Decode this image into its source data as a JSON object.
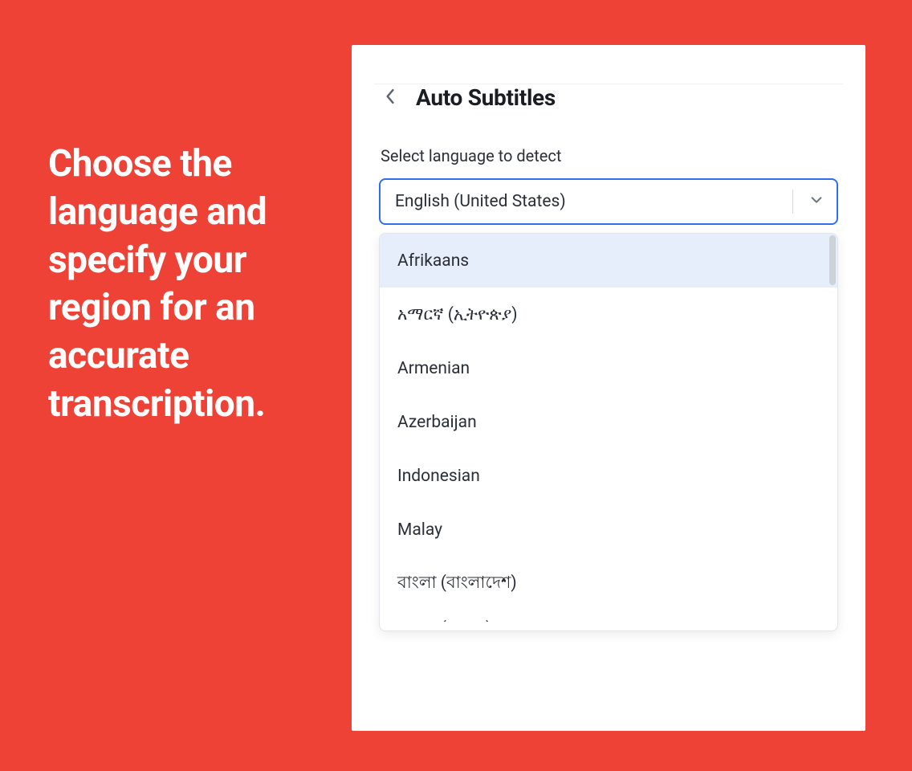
{
  "promo": {
    "text": "Choose the language and specify your region for an accurate transcription."
  },
  "panel": {
    "title": "Auto Subtitles",
    "field_label": "Select language to detect",
    "selected_value": "English (United States)",
    "options": [
      "Afrikaans",
      "አማርኛ (ኢትዮጵያ)",
      "Armenian",
      "Azerbaijan",
      "Indonesian",
      "Malay",
      "বাংলা (বাংলাদেশ)"
    ],
    "partial_option": "বাংলা (ভারত)"
  }
}
